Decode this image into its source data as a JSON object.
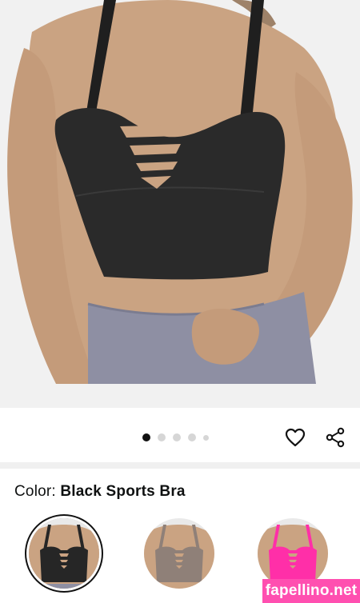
{
  "product_image": {
    "alt": "Black Sports Bra product photo",
    "colors": {
      "bra": "#2a2a2a",
      "leggings": "#8e8fa3",
      "skin": "#caa382",
      "background": "#f1f1f1"
    }
  },
  "carousel": {
    "dot_count": 5,
    "active_index": 0
  },
  "actions": {
    "wishlist_icon": "heart-icon",
    "share_icon": "share-icon"
  },
  "color_selector": {
    "label": "Color: ",
    "selected_value": "Black Sports Bra",
    "options": [
      {
        "name": "black",
        "color": "#262626",
        "selected": true
      },
      {
        "name": "taupe",
        "color": "#8f8078",
        "selected": false
      },
      {
        "name": "pink",
        "color": "#ff2fa8",
        "selected": false
      }
    ]
  },
  "watermark": {
    "text": "fapellino.net"
  }
}
